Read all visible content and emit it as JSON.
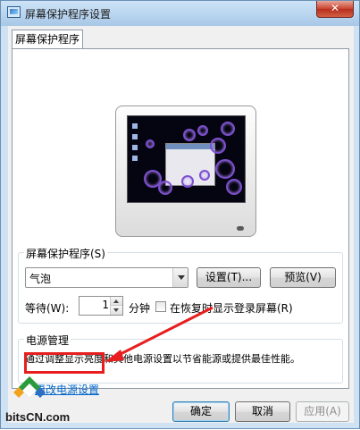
{
  "window": {
    "title": "屏幕保护程序设置",
    "close_glyph": "✕"
  },
  "tab": {
    "label": "屏幕保护程序"
  },
  "screensaver": {
    "group_label": "屏幕保护程序(S)",
    "selected": "气泡",
    "settings_button": "设置(T)...",
    "preview_button": "预览(V)",
    "wait_label": "等待(W):",
    "wait_value": "1",
    "minutes_unit": "分钟",
    "resume_checkbox_label": "在恢复时显示登录屏幕(R)",
    "resume_checked": false
  },
  "power": {
    "group_label": "电源管理",
    "description": "通过调整显示亮度和其他电源设置以节省能源或提供最佳性能。",
    "link": "更改电源设置"
  },
  "footer": {
    "ok": "确定",
    "cancel": "取消",
    "apply": "应用(A)"
  },
  "watermark": {
    "text": "bitsCN.com"
  },
  "colors": {
    "highlight_red": "#e81e1e",
    "link_blue": "#0066cc",
    "bubble_purple": "#7d4fd0"
  }
}
